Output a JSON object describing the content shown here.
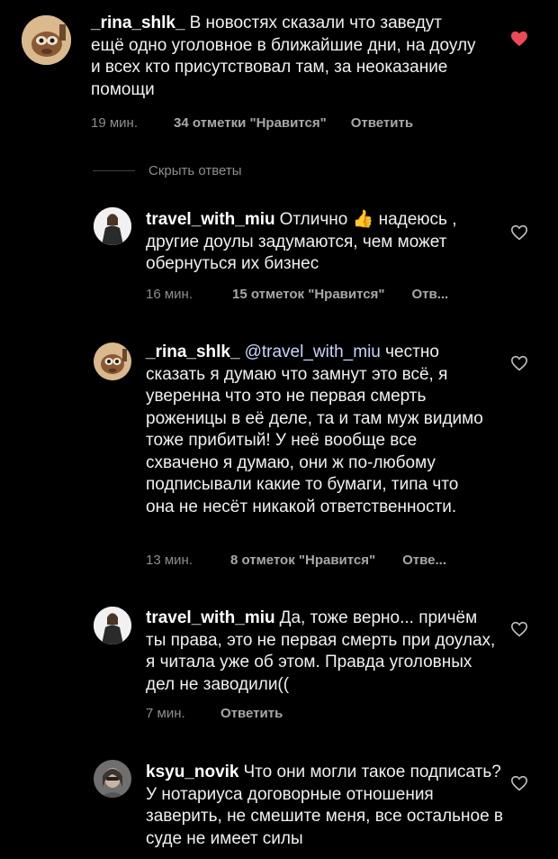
{
  "comments": [
    {
      "username": "_rina_shlk_",
      "text": "В новостях сказали что заведут ещё одно уголовное в ближайшие дни, на доулу и всех кто присутствовал там, за неоказание помощи",
      "time": "19 мин.",
      "likes": "34 отметки \"Нравится\"",
      "reply": "Ответить",
      "liked": true
    },
    {
      "username": "travel_with_miu",
      "text_before_emoji": "Отлично",
      "emoji": "👍",
      "text_after_emoji": "надеюсь , другие доулы задумаются, чем может обернуться их бизнес",
      "time": "16 мин.",
      "likes": "15 отметок \"Нравится\"",
      "reply": "Отв...",
      "liked": false
    },
    {
      "username": "_rina_shlk_",
      "mention": "@travel_with_miu",
      "text": "честно сказать я думаю что замнут это всё, я уверенна что это не первая смерть роженицы в её деле, та и там муж видимо тоже прибитый! У неё вообще все схвачено я думаю, они ж по-любому подписывали какие то бумаги, типа что она не несёт никакой ответственности.",
      "time": "13 мин.",
      "likes": "8 отметок \"Нравится\"",
      "reply": "Отве...",
      "liked": false
    },
    {
      "username": "travel_with_miu",
      "text": "Да, тоже верно... причём ты права, это не первая смерть при доулах, я читала уже об этом. Правда уголовных дел не заводили((",
      "time": "7 мин.",
      "reply": "Ответить",
      "liked": false
    },
    {
      "username": "ksyu_novik",
      "text": "Что они могли такое подписать? У нотариуса договорные отношения заверить, не смешите меня, все остальное в суде не имеет силы",
      "liked": false
    }
  ],
  "hide_replies_label": "Скрыть ответы",
  "icons": {
    "heart_filled": "heart-filled-icon",
    "heart_outline": "heart-outline-icon"
  },
  "colors": {
    "background": "#000000",
    "heart_liked": "#ed4956",
    "meta": "#8e8e8e"
  }
}
